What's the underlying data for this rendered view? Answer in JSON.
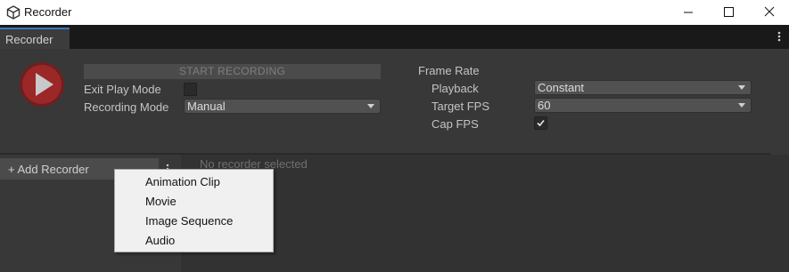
{
  "window": {
    "title": "Recorder",
    "icon": "unity-icon",
    "controls": [
      "minimize-icon",
      "maximize-icon",
      "close-icon"
    ]
  },
  "tab": {
    "label": "Recorder",
    "menu_icon": "kebab-menu-icon"
  },
  "controls": {
    "start_recording_label": "START RECORDING",
    "exit_play_mode_label": "Exit Play Mode",
    "exit_play_mode_checked": false,
    "recording_mode_label": "Recording Mode",
    "recording_mode_value": "Manual"
  },
  "frame_rate": {
    "heading": "Frame Rate",
    "playback_label": "Playback",
    "playback_value": "Constant",
    "target_fps_label": "Target FPS",
    "target_fps_value": "60",
    "cap_fps_label": "Cap FPS",
    "cap_fps_checked": true
  },
  "recorders": {
    "add_label": "+ Add Recorder",
    "empty_message": "No recorder selected"
  },
  "popup_menu": {
    "items": [
      "Animation Clip",
      "Movie",
      "Image Sequence",
      "Audio"
    ]
  },
  "colors": {
    "record_button": "#9c2727",
    "tab_accent": "#3a79bb",
    "background": "#383838"
  }
}
